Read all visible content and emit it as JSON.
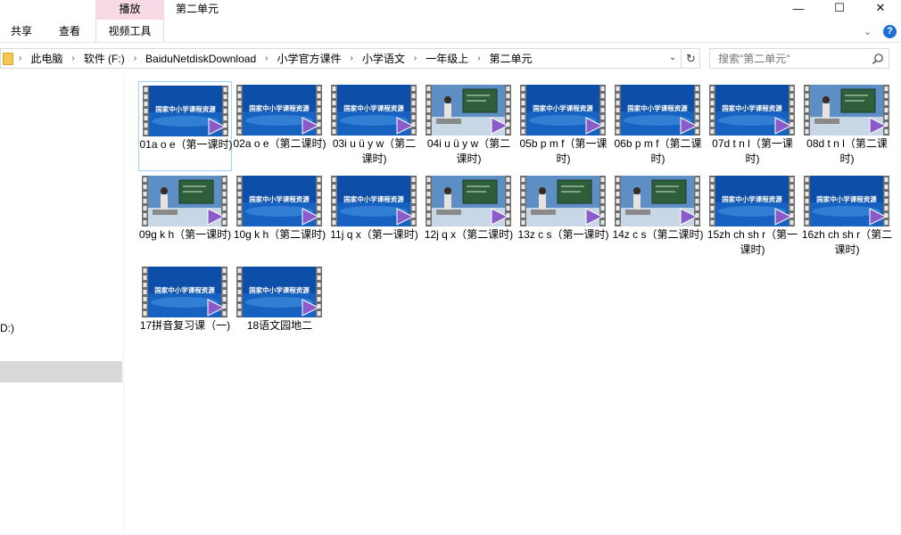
{
  "window": {
    "title": "第二单元",
    "context_tab_label": "播放",
    "controls": {
      "minimize": "—",
      "maximize": "☐",
      "close": "✕"
    }
  },
  "ribbon": {
    "tabs": [
      "共享",
      "查看",
      "视频工具"
    ],
    "collapse_icon": "chevron-down-icon",
    "help": "?"
  },
  "address": {
    "breadcrumb": [
      "此电脑",
      "软件 (F:)",
      "BaiduNetdiskDownload",
      "小学官方课件",
      "小学语文",
      "一年级上",
      "第二单元"
    ],
    "separator": "›",
    "dropdown": "⌄",
    "refresh": "↻"
  },
  "search": {
    "placeholder": "搜索\"第二单元\""
  },
  "nav": {
    "drive_label": "D:)"
  },
  "colors": {
    "context_tab": "#f8d9e6",
    "selection_border": "#99d1ff",
    "thumb_blue": "#0d4fa8",
    "film_strip": "#7a7a7a",
    "play_overlay": "#8b5cc9"
  },
  "files": [
    {
      "name": "01a o e（第一课时)",
      "thumb": "banner",
      "selected": true
    },
    {
      "name": "02a o e（第二课时)",
      "thumb": "banner",
      "selected": false
    },
    {
      "name": "03i u ü y w（第二课时)",
      "thumb": "banner",
      "selected": false
    },
    {
      "name": "04i u ü y w（第二课时)",
      "thumb": "class",
      "selected": false
    },
    {
      "name": "05b p m f（第一课时)",
      "thumb": "banner",
      "selected": false
    },
    {
      "name": "06b p m f（第二课时)",
      "thumb": "banner",
      "selected": false
    },
    {
      "name": "07d t n l（第一课时)",
      "thumb": "banner",
      "selected": false
    },
    {
      "name": "08d t n l（第二课时)",
      "thumb": "class",
      "selected": false
    },
    {
      "name": "09g k h（第一课时)",
      "thumb": "class",
      "selected": false
    },
    {
      "name": "10g k h（第二课时)",
      "thumb": "banner",
      "selected": false
    },
    {
      "name": "11j q x（第一课时)",
      "thumb": "banner",
      "selected": false
    },
    {
      "name": "12j q x（第二课时)",
      "thumb": "class",
      "selected": false
    },
    {
      "name": "13z c s（第一课时)",
      "thumb": "class",
      "selected": false
    },
    {
      "name": "14z c s（第二课时)",
      "thumb": "class",
      "selected": false
    },
    {
      "name": "15zh ch sh r（第一课时)",
      "thumb": "banner",
      "selected": false
    },
    {
      "name": "16zh ch sh r（第二课时)",
      "thumb": "banner",
      "selected": false
    },
    {
      "name": "17拼音复习课（一)",
      "thumb": "banner",
      "selected": false
    },
    {
      "name": "18语文园地二",
      "thumb": "banner",
      "selected": false
    }
  ],
  "thumb_banner_text": "国家中小学课程资源"
}
